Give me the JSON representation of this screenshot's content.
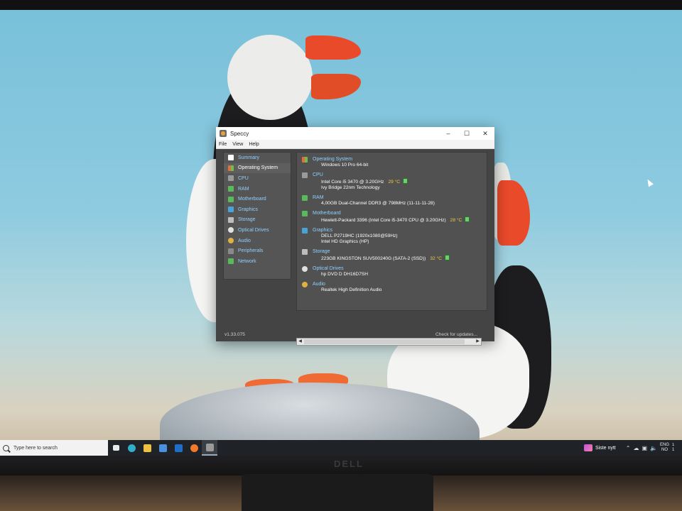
{
  "window": {
    "title": "Speccy",
    "controls": {
      "minimize": "–",
      "maximize": "☐",
      "close": "✕"
    }
  },
  "menu": [
    "File",
    "View",
    "Help"
  ],
  "sidebar": {
    "items": [
      {
        "label": "Summary",
        "icon": "summary-icon",
        "color": "#ffffff"
      },
      {
        "label": "Operating System",
        "icon": "windows-logo-icon",
        "color": "#e86b3a"
      },
      {
        "label": "CPU",
        "icon": "cpu-icon",
        "color": "#9a9a9a"
      },
      {
        "label": "RAM",
        "icon": "ram-icon",
        "color": "#5ab95a"
      },
      {
        "label": "Motherboard",
        "icon": "motherboard-icon",
        "color": "#5ab95a"
      },
      {
        "label": "Graphics",
        "icon": "graphics-icon",
        "color": "#4aa3d8"
      },
      {
        "label": "Storage",
        "icon": "storage-icon",
        "color": "#bdbdbd"
      },
      {
        "label": "Optical Drives",
        "icon": "optical-drive-icon",
        "color": "#e0e0e0"
      },
      {
        "label": "Audio",
        "icon": "audio-icon",
        "color": "#e0b040"
      },
      {
        "label": "Peripherals",
        "icon": "peripherals-icon",
        "color": "#8a8a8a"
      },
      {
        "label": "Network",
        "icon": "network-icon",
        "color": "#5ab95a"
      }
    ],
    "active_index": 1
  },
  "summary": {
    "os": {
      "title": "Operating System",
      "lines": [
        "Windows 10 Pro 64-bit"
      ],
      "icon_color": "#e86b3a"
    },
    "cpu": {
      "title": "CPU",
      "line1": "Intel Core i5 3470 @ 3.20GHz",
      "temp": "29 °C",
      "line2": "Ivy Bridge 22nm Technology",
      "icon_color": "#9a9a9a"
    },
    "ram": {
      "title": "RAM",
      "line1": "4,00GB Dual-Channel DDR3 @ 798MHz (11-11-11-28)",
      "icon_color": "#5ab95a"
    },
    "motherboard": {
      "title": "Motherboard",
      "line1": "Hewlett-Packard 3396 (Intel Core i5-3470 CPU @ 3.20GHz)",
      "temp": "28 °C",
      "icon_color": "#5ab95a"
    },
    "graphics": {
      "title": "Graphics",
      "line1": "DELL P2719HC (1920x1080@59Hz)",
      "line2": "Intel HD Graphics (HP)",
      "icon_color": "#4aa3d8"
    },
    "storage": {
      "title": "Storage",
      "line1": "223GB KINGSTON SUV500240G (SATA-2 (SSD))",
      "temp": "32 °C",
      "icon_color": "#bdbdbd"
    },
    "optical": {
      "title": "Optical Drives",
      "line1": "hp DVD D DH16D7SH",
      "icon_color": "#e0e0e0"
    },
    "audio": {
      "title": "Audio",
      "line1": "Realtek High Definition Audio",
      "icon_color": "#e0b040"
    }
  },
  "footer": {
    "version": "v1.33.075",
    "check_updates": "Check for updates..."
  },
  "taskbar": {
    "search_placeholder": "Type here to search",
    "apps": [
      {
        "name": "task-view-icon",
        "color": "#e8e8e8"
      },
      {
        "name": "edge-icon",
        "color": "#2fb0c8"
      },
      {
        "name": "file-explorer-icon",
        "color": "#f0c040"
      },
      {
        "name": "store-icon",
        "color": "#4a8fe0"
      },
      {
        "name": "outlook-icon",
        "color": "#1f6fc8"
      },
      {
        "name": "firefox-icon",
        "color": "#f07a2a"
      },
      {
        "name": "speccy-icon",
        "color": "#9a9a9a"
      }
    ],
    "news_label": "Siste nytt",
    "language_line1": "ENG",
    "language_line2": "NO",
    "clock_line1": "1",
    "clock_line2": "1"
  }
}
